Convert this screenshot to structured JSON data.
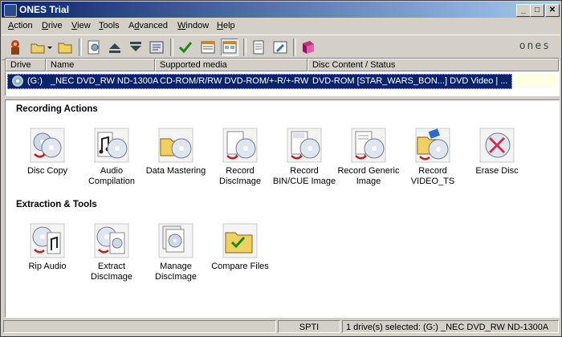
{
  "window": {
    "title": "ONES Trial"
  },
  "titlebar_buttons": {
    "minimize": "_",
    "maximize": "□",
    "close": "✕"
  },
  "menu": [
    {
      "label": "Action",
      "accel": "A"
    },
    {
      "label": "Drive",
      "accel": "D"
    },
    {
      "label": "View",
      "accel": "V"
    },
    {
      "label": "Tools",
      "accel": "T"
    },
    {
      "label": "Advanced",
      "accel": "d"
    },
    {
      "label": "Window",
      "accel": "W"
    },
    {
      "label": "Help",
      "accel": "H"
    }
  ],
  "toolbar": {
    "logo": "ones",
    "buttons": [
      "wizard",
      "open-dropdown",
      "folder",
      "properties",
      "eject",
      "load",
      "drive-info",
      "check",
      "view-details",
      "view-icons",
      "document",
      "edit",
      "book"
    ]
  },
  "drives": {
    "columns": [
      "Drive",
      "Name",
      "Supported media",
      "Disc Content / Status"
    ],
    "rows": [
      {
        "drive": "(G:)",
        "name": "_NEC DVD_RW ND-1300A",
        "media": "CD-ROM/R/RW DVD-ROM/+-R/+-RW",
        "status": "DVD-ROM [STAR_WARS_BON...] DVD Video | ..."
      }
    ]
  },
  "sections": {
    "recording": {
      "title": "Recording Actions",
      "items": [
        {
          "label": "Disc Copy"
        },
        {
          "label": "Audio Compilation"
        },
        {
          "label": "Data Mastering"
        },
        {
          "label": "Record DiscImage"
        },
        {
          "label": "Record BIN/CUE Image"
        },
        {
          "label": "Record Generic Image"
        },
        {
          "label": "Record VIDEO_TS"
        },
        {
          "label": "Erase Disc"
        }
      ]
    },
    "extraction": {
      "title": "Extraction & Tools",
      "items": [
        {
          "label": "Rip Audio"
        },
        {
          "label": "Extract DiscImage"
        },
        {
          "label": "Manage DiscImage"
        },
        {
          "label": "Compare Files"
        }
      ]
    }
  },
  "statusbar": {
    "interface": "SPTI",
    "selection": "1 drive(s) selected: (G:) _NEC DVD_RW ND-1300A"
  }
}
